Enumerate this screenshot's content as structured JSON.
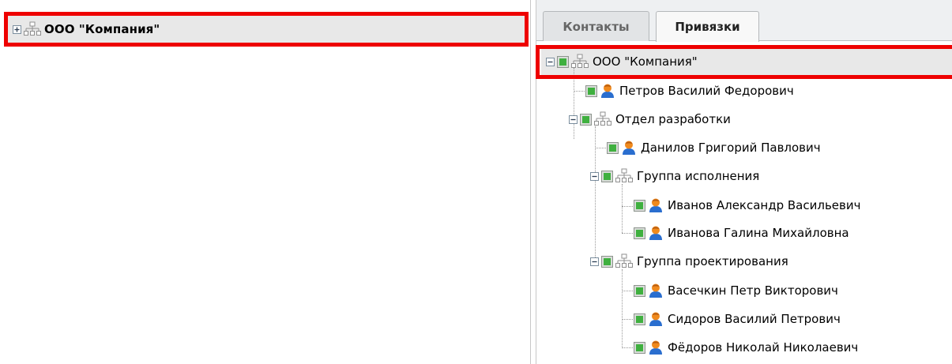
{
  "left_tree": {
    "root": {
      "label": "ООО \"Компания\"",
      "expanded": false
    }
  },
  "tabs": [
    {
      "label": "Контакты",
      "active": false
    },
    {
      "label": "Привязки",
      "active": true
    }
  ],
  "right_tree": {
    "root": {
      "label": "ООО \"Компания\""
    },
    "nodes": {
      "petrov": "Петров Василий Федорович",
      "dept_dev": "Отдел разработки",
      "danilov": "Данилов Григорий Павлович",
      "group_exec": "Группа исполнения",
      "ivanov": "Иванов Александр Васильевич",
      "ivanova": "Иванова Галина Михайловна",
      "group_design": "Группа проектирования",
      "vasechkin": "Васечкин Петр Викторович",
      "sidorov": "Сидоров Василий Петрович",
      "fedorov": "Фёдоров Николай Николаевич"
    }
  },
  "icons": {
    "org": "org-structure-icon",
    "person": "person-icon",
    "expand": "plus-box-icon",
    "collapse": "minus-box-icon",
    "check": "green-check-icon"
  },
  "colors": {
    "highlight": "#ee0000",
    "selected_row": "#e8e8e8",
    "person_orange": "#f08a1d",
    "person_blue": "#2a6ecf",
    "check_green": "#3fb03f"
  }
}
